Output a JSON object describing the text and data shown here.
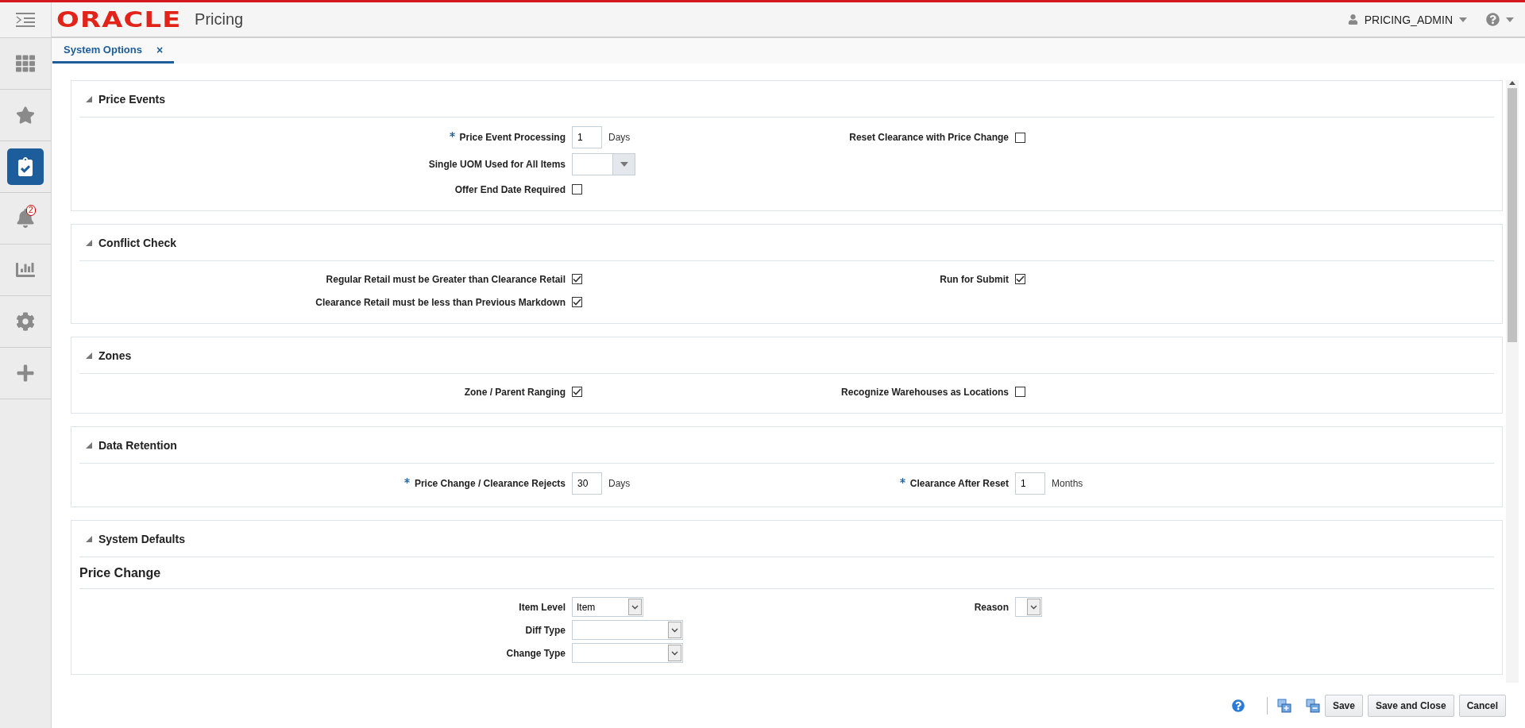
{
  "header": {
    "logo": "ORACLE",
    "app_title": "Pricing",
    "user": "PRICING_ADMIN"
  },
  "sidebar": {
    "items": [
      {
        "kind": "grid",
        "selected": false
      },
      {
        "kind": "star",
        "selected": false
      },
      {
        "kind": "tasks",
        "selected": true
      },
      {
        "kind": "bell",
        "selected": false,
        "badge": "2"
      },
      {
        "kind": "chart",
        "selected": false
      },
      {
        "kind": "gear",
        "selected": false
      },
      {
        "kind": "plus",
        "selected": false
      }
    ]
  },
  "tabs": [
    {
      "label": "System Options",
      "close": "×",
      "selected": true
    }
  ],
  "sections": [
    {
      "title": "Price Events",
      "rows": [
        {
          "left": {
            "kind": "text",
            "label": "Price Event Processing",
            "required": true,
            "value": "1",
            "unit": "Days"
          },
          "right": {
            "kind": "checkbox",
            "label": "Reset Clearance with Price Change",
            "checked": false
          }
        },
        {
          "left": {
            "kind": "dropdown",
            "label": "Single UOM Used for All Items"
          }
        },
        {
          "left": {
            "kind": "checkbox",
            "label": "Offer End Date Required",
            "checked": false
          }
        }
      ]
    },
    {
      "title": "Conflict Check",
      "rows": [
        {
          "left": {
            "kind": "checkbox",
            "label": "Regular Retail must be Greater than Clearance Retail",
            "checked": true
          },
          "right": {
            "kind": "checkbox",
            "label": "Run for Submit",
            "checked": true
          }
        },
        {
          "left": {
            "kind": "checkbox",
            "label": "Clearance Retail must be less than Previous Markdown",
            "checked": true
          }
        }
      ]
    },
    {
      "title": "Zones",
      "rows": [
        {
          "left": {
            "kind": "checkbox",
            "label": "Zone / Parent Ranging",
            "checked": true
          },
          "right": {
            "kind": "checkbox",
            "label": "Recognize Warehouses as Locations",
            "checked": false
          }
        }
      ]
    },
    {
      "title": "Data Retention",
      "rows": [
        {
          "left": {
            "kind": "text",
            "label": "Price Change / Clearance Rejects",
            "required": true,
            "value": "30",
            "unit": "Days"
          },
          "right": {
            "kind": "text",
            "label": "Clearance After Reset",
            "required": true,
            "value": "1",
            "unit": "Months"
          }
        }
      ]
    },
    {
      "title": "System Defaults",
      "subheading": "Price Change",
      "rows": [
        {
          "left": {
            "kind": "choice",
            "label": "Item Level",
            "value": "Item"
          },
          "right": {
            "kind": "choice",
            "label": "Reason"
          }
        },
        {
          "left": {
            "kind": "choice",
            "label": "Diff Type"
          }
        },
        {
          "left": {
            "kind": "choice",
            "label": "Change Type"
          }
        }
      ]
    }
  ],
  "footer": {
    "buttons": [
      "Save",
      "Save and Close",
      "Cancel"
    ]
  }
}
